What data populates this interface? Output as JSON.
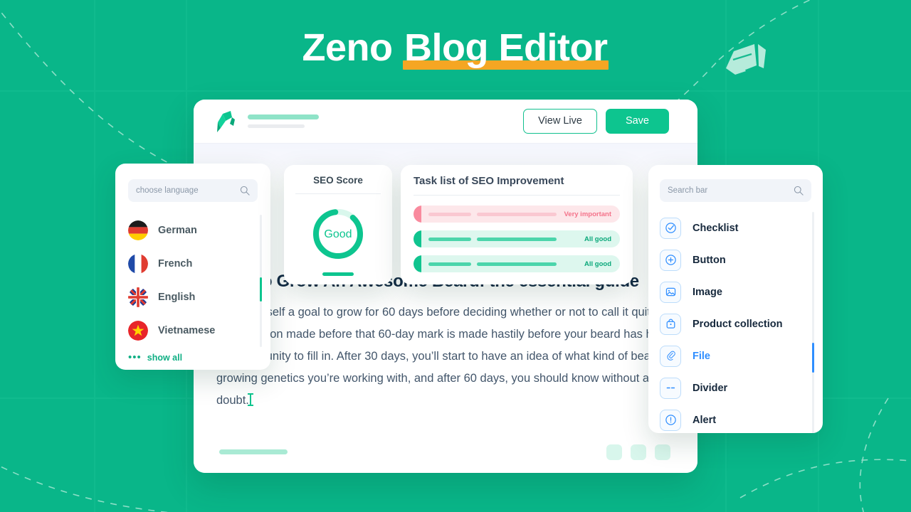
{
  "hero": {
    "title_plain": "Zeno ",
    "title_highlight": "Blog Editor"
  },
  "editor": {
    "pen_icon": "pen-nib-icon",
    "view_live_label": "View Live",
    "save_label": "Save",
    "article": {
      "heading": "How to Grow An Awesome Beard: the essential guide",
      "body": "Give yourself a goal to grow for 60 days before deciding whether or not to call it quits. Any decision made before that 60-day mark is made hastily before your beard has had an opportunity to fill in. After 30 days, you’ll start to have an idea of what kind of beard-growing genetics you’re working with, and after 60 days, you should know without a doubt."
    }
  },
  "language_panel": {
    "search_placeholder": "choose language",
    "search_icon": "search-icon",
    "items": [
      {
        "label": "German",
        "flag": "flag-de"
      },
      {
        "label": "French",
        "flag": "flag-fr"
      },
      {
        "label": "English",
        "flag": "flag-gb"
      },
      {
        "label": "Vietnamese",
        "flag": "flag-vn"
      }
    ],
    "show_all_label": "show all"
  },
  "seo_card": {
    "title": "SEO Score",
    "score_label": "Good",
    "gauge_percent": 86,
    "accent": "#0dc58f"
  },
  "task_card": {
    "title": "Task list of SEO Improvement",
    "rows": [
      {
        "status": "Very important",
        "tone": "danger"
      },
      {
        "status": "All good",
        "tone": "good"
      },
      {
        "status": "All good",
        "tone": "good"
      }
    ]
  },
  "blocks_panel": {
    "search_placeholder": "Search bar",
    "search_icon": "search-icon",
    "items": [
      {
        "label": "Checklist",
        "icon": "check-circle-icon",
        "active": false
      },
      {
        "label": "Button",
        "icon": "plus-circle-icon",
        "active": false
      },
      {
        "label": "Image",
        "icon": "image-icon",
        "active": false
      },
      {
        "label": "Product collection",
        "icon": "shopping-bag-icon",
        "active": false
      },
      {
        "label": "File",
        "icon": "paperclip-icon",
        "active": true
      },
      {
        "label": "Divider",
        "icon": "divider-icon",
        "active": false
      },
      {
        "label": "Alert",
        "icon": "alert-circle-icon",
        "active": false
      }
    ]
  },
  "colors": {
    "background_green": "#09b689",
    "accent_green": "#0dc58f",
    "highlight_orange": "#f5a623",
    "accent_blue": "#2f8eff",
    "danger_pink": "#f98a9e"
  }
}
